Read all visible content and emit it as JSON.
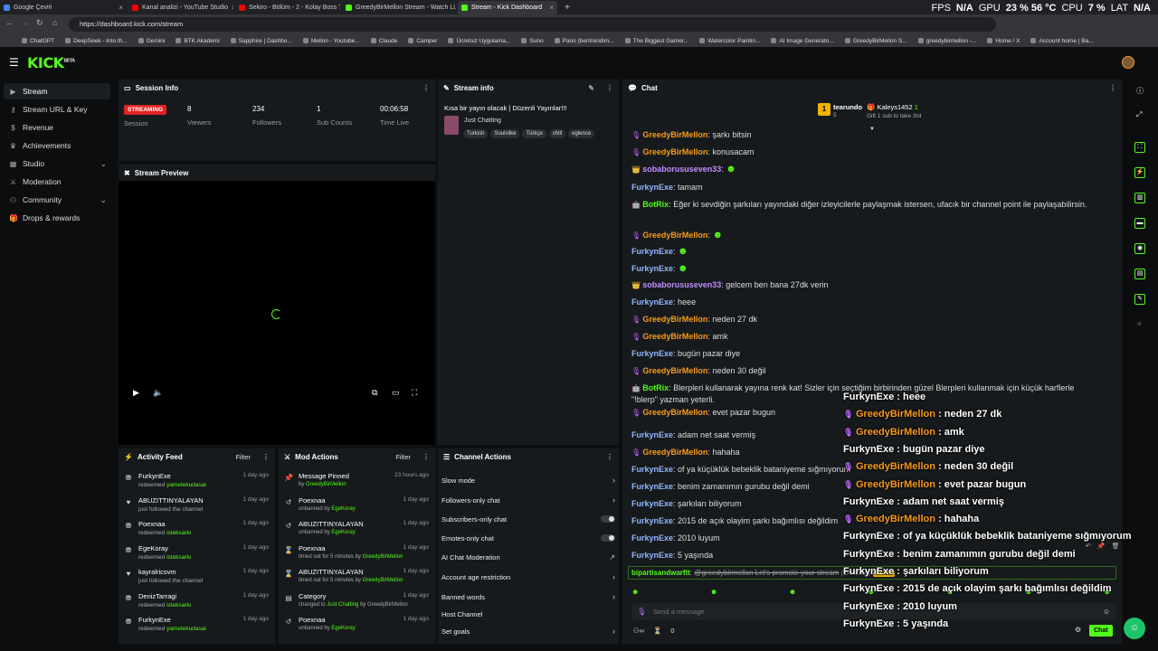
{
  "browser": {
    "tabs": [
      {
        "title": "Google Çeviri",
        "color": "#4285f4"
      },
      {
        "title": "Kanal analizi - YouTube Studio",
        "color": "#ff0000"
      },
      {
        "title": "Sekiro - Bölüm - 2 - Kolay Boss ?!!",
        "color": "#ff0000"
      },
      {
        "title": "GreedyBirMellon Stream - Watch Li...",
        "color": "#53fc18"
      },
      {
        "title": "Stream - Kick Dashboard",
        "color": "#53fc18"
      }
    ],
    "url": "https://dashboard.kick.com/stream",
    "bookmarks": [
      "ChatGPT",
      "DeepSeek - Into th...",
      "Gemini",
      "BTK Akademi",
      "Sapphire | Dashbo...",
      "Mellon - Youtube...",
      "Claude",
      "Camper",
      "Ücretsiz Uygulama...",
      "Suno",
      "Pano (bentrendim...",
      "The Biggest Gamer...",
      "Watercolor Paintin...",
      "AI Image Generato...",
      "GreedyBirMellon S...",
      "greedybirmellon -...",
      "Home / X",
      "Account home | Ba..."
    ],
    "new_tab": "+"
  },
  "hud": {
    "fps_label": "FPS",
    "fps": "N/A",
    "gpu_label": "GPU",
    "gpu": "23 % 56 °C",
    "cpu_label": "CPU",
    "cpu": "7 %",
    "lat_label": "LAT",
    "lat": "N/A"
  },
  "app": {
    "logo": "KICK",
    "logo_sup": "BETA"
  },
  "sidebar": {
    "items": [
      {
        "label": "Stream",
        "icon": "play-icon",
        "active": true
      },
      {
        "label": "Stream URL & Key",
        "icon": "key-icon"
      },
      {
        "label": "Revenue",
        "icon": "revenue-icon"
      },
      {
        "label": "Achievements",
        "icon": "trophy-icon"
      },
      {
        "label": "Studio",
        "icon": "studio-icon",
        "chevron": true
      },
      {
        "label": "Moderation",
        "icon": "sword-icon"
      },
      {
        "label": "Community",
        "icon": "people-icon",
        "chevron": true
      },
      {
        "label": "Drops & rewards",
        "icon": "gift-icon"
      }
    ]
  },
  "session": {
    "title": "Session Info",
    "status": "STREAMING",
    "session_label": "Session",
    "viewers": "8",
    "viewers_label": "Viewers",
    "followers": "234",
    "followers_label": "Followers",
    "subs": "1",
    "subs_label": "Sub Counts",
    "time": "00:06:58",
    "time_label": "Time Live"
  },
  "stream_info": {
    "title": "Stream info",
    "stream_title": "Kısa bir yayın olacak | Düzenli Yayınlar!!!",
    "category": "Just Chatting",
    "tags": [
      "Turkish",
      "Soulslike",
      "Türkçe",
      "chill",
      "eglence"
    ]
  },
  "preview": {
    "title": "Stream Preview"
  },
  "activity": {
    "title": "Activity Feed",
    "filter": "Filter",
    "items": [
      {
        "name": "FurkynExe",
        "sub": "redeemed",
        "hl": "yametekudasai",
        "time": "1 day ago",
        "icon": "reward-icon"
      },
      {
        "name": "ABUZITTINYALAYAN",
        "sub": "just followed the channel",
        "hl": "",
        "time": "1 day ago",
        "icon": "heart-icon"
      },
      {
        "name": "Poexnaa",
        "sub": "redeemed",
        "hl": "isteksarkı",
        "time": "1 day ago",
        "icon": "reward-icon"
      },
      {
        "name": "EgeKoray",
        "sub": "redeemed",
        "hl": "isteksarkı",
        "time": "1 day ago",
        "icon": "reward-icon"
      },
      {
        "name": "kayralricsvm",
        "sub": "just followed the channel",
        "hl": "",
        "time": "1 day ago",
        "icon": "heart-icon"
      },
      {
        "name": "DenizTarragi",
        "sub": "redeemed",
        "hl": "isteksarkı",
        "time": "1 day ago",
        "icon": "reward-icon"
      },
      {
        "name": "FurkynExe",
        "sub": "redeemed",
        "hl": "yametekudasai",
        "time": "1 day ago",
        "icon": "reward-icon"
      }
    ]
  },
  "mod_actions": {
    "title": "Mod Actions",
    "filter": "Filter",
    "items": [
      {
        "name": "Message Pinned",
        "pre": "by",
        "hl": "GreedyBirMellon",
        "post": "",
        "time": "23 hours ago",
        "icon": "pin-icon"
      },
      {
        "name": "Poexnaa",
        "pre": "unbanned by",
        "hl": "EgeKoray",
        "post": "",
        "time": "1 day ago",
        "icon": "undo-icon"
      },
      {
        "name": "ABUZITTINYALAYAN",
        "pre": "unbanned by",
        "hl": "EgeKoray",
        "post": "",
        "time": "1 day ago",
        "icon": "undo-icon"
      },
      {
        "name": "Poexnaa",
        "pre": "timed out for 5 minutes by",
        "hl": "GreedyBirMellon",
        "post": "",
        "time": "1 day ago",
        "icon": "hourglass-icon"
      },
      {
        "name": "ABUZITTINYALAYAN",
        "pre": "timed out for 5 minutes by",
        "hl": "GreedyBirMellon",
        "post": "",
        "time": "1 day ago",
        "icon": "hourglass-icon"
      },
      {
        "name": "Category",
        "pre": "changed to",
        "hl": "Just Chatting",
        "post": "by GreedyBirMellon",
        "time": "1 day ago",
        "icon": "category-icon"
      },
      {
        "name": "Poexnaa",
        "pre": "unbanned by",
        "hl": "EgeKoray",
        "post": "",
        "time": "1 day ago",
        "icon": "undo-icon"
      }
    ]
  },
  "channel_actions": {
    "title": "Channel Actions",
    "items": [
      {
        "label": "Slow mode",
        "ctrl": "chevron"
      },
      {
        "label": "Followers-only chat",
        "ctrl": "chevron"
      },
      {
        "label": "Subscribers-only chat",
        "ctrl": "toggle"
      },
      {
        "label": "Emotes-only chat",
        "ctrl": "toggle"
      },
      {
        "label": "AI Chat Moderation",
        "ctrl": "ext"
      },
      {
        "label": "Account age restriction",
        "ctrl": "chevron"
      },
      {
        "label": "Banned words",
        "ctrl": "chevron"
      },
      {
        "label": "Host Channel",
        "ctrl": "none"
      },
      {
        "label": "Set goals",
        "ctrl": "chevron"
      }
    ]
  },
  "chat": {
    "title": "Chat",
    "gifter": {
      "rank": "1",
      "name": "tearundo",
      "count": "5"
    },
    "gift_target": {
      "name": "Kaleys1452",
      "count": "1",
      "text": "Gift 1 sub to take 3rd"
    },
    "messages": [
      {
        "user": "GreedyBirMellon",
        "color": "#f79b1c",
        "badge": "mic",
        "text": "şarkı bitsin"
      },
      {
        "user": "GreedyBirMellon",
        "color": "#f79b1c",
        "badge": "mic",
        "text": "konusacam"
      },
      {
        "user": "sobaborususeven33",
        "color": "#c08cff",
        "badge": "vip",
        "text": ""
      },
      {
        "user": "FurkynExe",
        "color": "#8fb7ff",
        "badge": "",
        "text": "tamam"
      },
      {
        "user": "BotRix",
        "color": "#53fc18",
        "badge": "bot",
        "text": "Eğer ki sevdiğin şarkıları yayındaki diğer izleyicilerle paylaşmak istersen, ufacık bir channel point ile paylaşabilirsin."
      },
      {
        "user": "GreedyBirMellon",
        "color": "#f79b1c",
        "badge": "mic",
        "text": ""
      },
      {
        "user": "FurkynExe",
        "color": "#8fb7ff",
        "badge": "",
        "text": ""
      },
      {
        "user": "FurkynExe",
        "color": "#8fb7ff",
        "badge": "",
        "text": ""
      },
      {
        "user": "sobaborususeven33",
        "color": "#c08cff",
        "badge": "vip",
        "text": "gelcem ben bana 27dk verin"
      },
      {
        "user": "FurkynExe",
        "color": "#8fb7ff",
        "badge": "",
        "text": "heee"
      },
      {
        "user": "GreedyBirMellon",
        "color": "#f79b1c",
        "badge": "mic",
        "text": "neden 27 dk"
      },
      {
        "user": "GreedyBirMellon",
        "color": "#f79b1c",
        "badge": "mic",
        "text": "amk"
      },
      {
        "user": "FurkynExe",
        "color": "#8fb7ff",
        "badge": "",
        "text": "bugün pazar diye"
      },
      {
        "user": "GreedyBirMellon",
        "color": "#f79b1c",
        "badge": "mic",
        "text": "neden 30 değil"
      },
      {
        "user": "BotRix",
        "color": "#53fc18",
        "badge": "bot",
        "text": "Blerpleri kullanarak yayına renk kat! Sizler için seçtiğim birbirinden güzel Blerpleri kullanmak için küçük harflerle \"!blerp\" yazman yeterli."
      },
      {
        "user": "GreedyBirMellon",
        "color": "#f79b1c",
        "badge": "mic",
        "text": "evet pazar bugun"
      },
      {
        "user": "FurkynExe",
        "color": "#8fb7ff",
        "badge": "",
        "text": "adam net saat vermiş"
      },
      {
        "user": "GreedyBirMellon",
        "color": "#f79b1c",
        "badge": "mic",
        "text": "hahaha"
      },
      {
        "user": "FurkynExe",
        "color": "#8fb7ff",
        "badge": "",
        "text": "of ya küçüklük bebeklik bataniyeme sığmıyorum"
      },
      {
        "user": "FurkynExe",
        "color": "#8fb7ff",
        "badge": "",
        "text": "benim zamanımın gurubu değil demi"
      },
      {
        "user": "FurkynExe",
        "color": "#8fb7ff",
        "badge": "",
        "text": "şarkıları biliyorum"
      },
      {
        "user": "FurkynExe",
        "color": "#8fb7ff",
        "badge": "",
        "text": "2015 de açık olayim şarkı bağımlısı değildim"
      },
      {
        "user": "FurkynExe",
        "color": "#8fb7ff",
        "badge": "",
        "text": "2010 luyum"
      },
      {
        "user": "FurkynExe",
        "color": "#8fb7ff",
        "badge": "",
        "text": "5 yaşında"
      }
    ],
    "deleted": {
      "user": "bipartisandwarftt",
      "text": "@greedybirmellon Let's promote your stream",
      "deleted_label": "(Deleted)",
      "badge": "AI Mod"
    },
    "input_placeholder": "Send a message",
    "viewer_count": "0",
    "send": "Chat"
  },
  "overlay": [
    {
      "user": "FurkynExe",
      "orange": false,
      "text": "heee"
    },
    {
      "user": "GreedyBirMellon",
      "orange": true,
      "text": "neden 27 dk"
    },
    {
      "user": "GreedyBirMellon",
      "orange": true,
      "text": "amk"
    },
    {
      "user": "FurkynExe",
      "orange": false,
      "text": "bugün pazar diye"
    },
    {
      "user": "GreedyBirMellon",
      "orange": true,
      "text": "neden 30 değil"
    },
    {
      "user": "GreedyBirMellon",
      "orange": true,
      "text": "evet pazar bugun"
    },
    {
      "user": "FurkynExe",
      "orange": false,
      "text": "adam net saat vermiş"
    },
    {
      "user": "GreedyBirMellon",
      "orange": true,
      "text": "hahaha"
    },
    {
      "user": "FurkynExe",
      "orange": false,
      "text": "of ya küçüklük bebeklik bataniyeme sığmıyorum"
    },
    {
      "user": "FurkynExe",
      "orange": false,
      "text": "benim zamanımın gurubu değil demi"
    },
    {
      "user": "FurkynExe",
      "orange": false,
      "text": "şarkıları biliyorum"
    },
    {
      "user": "FurkynExe",
      "orange": false,
      "text": "2015 de açık olayim şarkı bağımlısı değildim"
    },
    {
      "user": "FurkynExe",
      "orange": false,
      "text": "2010 luyum"
    },
    {
      "user": "FurkynExe",
      "orange": false,
      "text": "5 yaşında"
    }
  ],
  "colors": {
    "accent": "#53fc18",
    "live": "#e02424",
    "panel": "#171a1c"
  }
}
